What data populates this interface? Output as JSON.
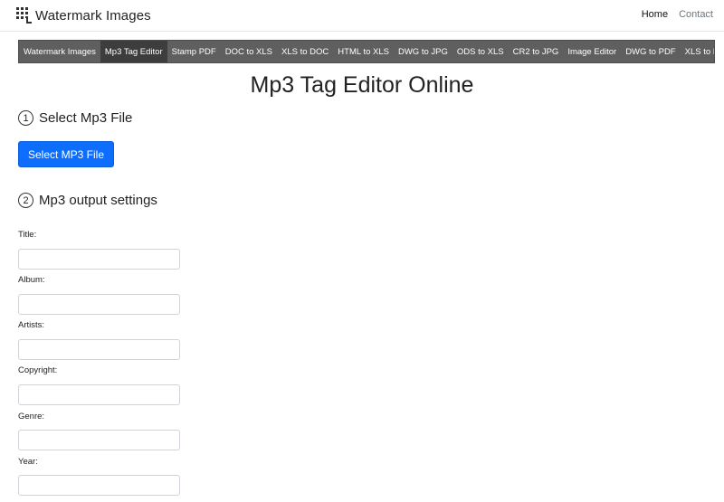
{
  "brand": {
    "name": "Watermark Images"
  },
  "nav": {
    "home": "Home",
    "contact": "Contact"
  },
  "tools": [
    "Watermark Images",
    "Mp3 Tag Editor",
    "Stamp PDF",
    "DOC to XLS",
    "XLS to DOC",
    "HTML to XLS",
    "DWG to JPG",
    "ODS to XLS",
    "CR2 to JPG",
    "Image Editor",
    "DWG to PDF",
    "XLS to PDF"
  ],
  "page": {
    "title": "Mp3 Tag Editor Online"
  },
  "step1": {
    "number": "1",
    "label": "Select Mp3 File",
    "button": "Select MP3 File"
  },
  "step2": {
    "number": "2",
    "label": "Mp3 output settings"
  },
  "fields": [
    {
      "label": "Title:",
      "value": ""
    },
    {
      "label": "Album:",
      "value": ""
    },
    {
      "label": "Artists:",
      "value": ""
    },
    {
      "label": "Copyright:",
      "value": ""
    },
    {
      "label": "Genre:",
      "value": ""
    },
    {
      "label": "Year:",
      "value": ""
    }
  ],
  "colors": {
    "accent": "#0d6efd",
    "toolbar": "#5f5f5f",
    "toolbar_active": "#3d3d3d"
  }
}
